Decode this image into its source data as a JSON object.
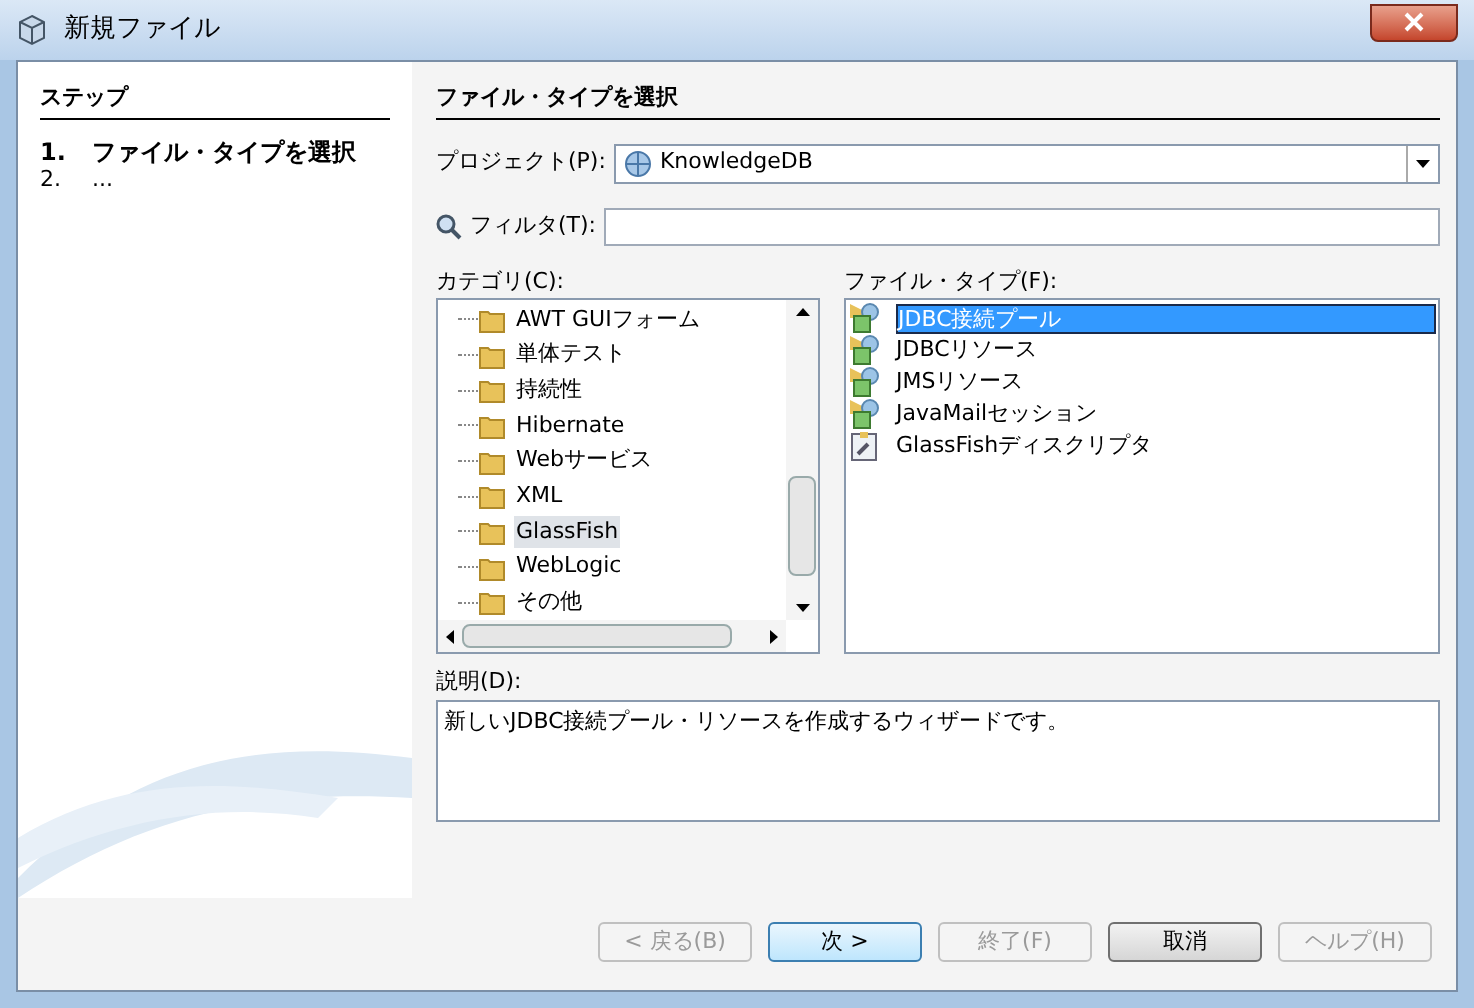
{
  "window": {
    "title": "新規ファイル"
  },
  "steps": {
    "heading": "ステップ",
    "items": [
      {
        "number": "1.",
        "label": "ファイル・タイプを選択",
        "selected": true
      },
      {
        "number": "2.",
        "label": "...",
        "selected": false
      }
    ]
  },
  "panel": {
    "heading": "ファイル・タイプを選択",
    "project": {
      "label": "プロジェクト(P):",
      "value": "KnowledgeDB"
    },
    "filter": {
      "label": "フィルタ(T):"
    },
    "categories": {
      "label": "カテゴリ(C):",
      "items": [
        {
          "label": "AWT GUIフォーム",
          "selected": false
        },
        {
          "label": "単体テスト",
          "selected": false
        },
        {
          "label": "持続性",
          "selected": false
        },
        {
          "label": "Hibernate",
          "selected": false
        },
        {
          "label": "Webサービス",
          "selected": false
        },
        {
          "label": "XML",
          "selected": false
        },
        {
          "label": "GlassFish",
          "selected": true
        },
        {
          "label": "WebLogic",
          "selected": false
        },
        {
          "label": "その他",
          "selected": false
        }
      ]
    },
    "file_types": {
      "label": "ファイル・タイプ(F):",
      "items": [
        {
          "label": "JDBC接続プール",
          "kind": "resource",
          "selected": true
        },
        {
          "label": "JDBCリソース",
          "kind": "resource",
          "selected": false
        },
        {
          "label": "JMSリソース",
          "kind": "resource",
          "selected": false
        },
        {
          "label": "JavaMailセッション",
          "kind": "resource",
          "selected": false
        },
        {
          "label": "GlassFishディスクリプタ",
          "kind": "descriptor",
          "selected": false
        }
      ]
    },
    "description": {
      "label": "説明(D):",
      "text": "新しいJDBC接続プール・リソースを作成するウィザードです。"
    }
  },
  "buttons": [
    {
      "label": "< 戻る(B)",
      "disabled": true,
      "default": false
    },
    {
      "label": "次 >",
      "disabled": false,
      "default": true
    },
    {
      "label": "終了(F)",
      "disabled": true,
      "default": false
    },
    {
      "label": "取消",
      "disabled": false,
      "default": false
    },
    {
      "label": "ヘルプ(H)",
      "disabled": true,
      "default": false
    }
  ]
}
